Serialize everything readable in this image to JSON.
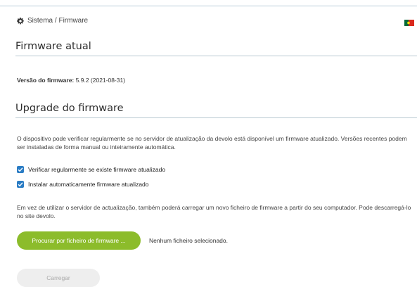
{
  "breadcrumb": {
    "icon": "gear-icon",
    "text": "Sistema / Firmware"
  },
  "language": {
    "flag": "portugal-flag-icon",
    "colors": [
      "#046a38",
      "#da291c"
    ]
  },
  "current_firmware": {
    "heading": "Firmware atual",
    "version_label": "Versão do firmware:",
    "version_value": "5.9.2 (2021-08-31)"
  },
  "upgrade": {
    "heading": "Upgrade do firmware",
    "description": "O dispositivo pode verificar regularmente se no servidor de atualização da devolo está disponível um firmware atualizado. Versões recentes podem ser instaladas de forma manual ou inteiramente automática.",
    "checkboxes": [
      {
        "label": "Verificar regularmente se existe firmware atualizado",
        "checked": true
      },
      {
        "label": "Instalar automaticamente firmware atualizado",
        "checked": true
      }
    ],
    "manual_description": "Em vez de utilizar o servidor de actualização, também poderá carregar um novo ficheiro de firmware a partir do seu computador. Pode descarregá-lo no site devolo.",
    "browse_button": "Procurar por ficheiro de firmware ...",
    "no_file": "Nenhum ficheiro selecionado.",
    "upload_button": "Carregar"
  },
  "colors": {
    "accent_green": "#8cbc2b",
    "checkbox_blue": "#2a7cc4",
    "divider": "#b9c9d2"
  }
}
